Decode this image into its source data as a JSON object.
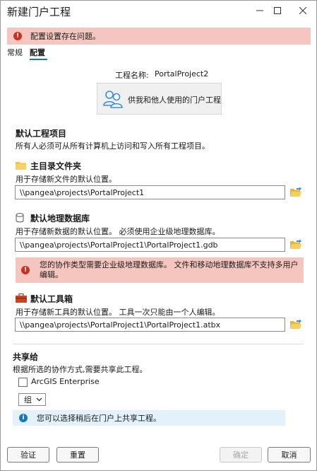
{
  "window": {
    "title": "新建门户工程",
    "minimize_icon": "minimize-icon",
    "maximize_icon": "maximize-icon",
    "close_icon": "close-icon"
  },
  "error_banner": {
    "text": "配置设置存在问题。",
    "icon": "error-icon"
  },
  "tabs": [
    {
      "label": "常规",
      "selected": false
    },
    {
      "label": "配置",
      "selected": true
    }
  ],
  "project": {
    "name_label": "工程名称:",
    "name_value": "PortalProject2",
    "type_label": "供我和他人使用的门户工程",
    "type_icon": "users-icon"
  },
  "defaults": {
    "title": "默认工程项目",
    "description": "所有人必须可从所有计算机上访问和写入所有工程项目。"
  },
  "home_folder": {
    "title": "主目录文件夹",
    "icon": "folder-icon",
    "description": "用于存储新文件的默认位置。",
    "path": "\\\\pangea\\projects\\PortalProject1"
  },
  "geodatabase": {
    "title": "默认地理数据库",
    "icon": "database-icon",
    "description": "用于存储新数据的默认位置。 必须使用企业级地理数据库。",
    "path": "\\\\pangea\\projects\\PortalProject1\\PortalProject1.gdb",
    "warning": "您的协作类型需要企业级地理数据库。 文件和移动地理数据库不支持多用户编辑。"
  },
  "toolbox": {
    "title": "默认工具箱",
    "icon": "toolbox-icon",
    "description": "用于存储新工具的默认位置。 工具一次只能由一个人编辑。",
    "path": "\\\\pangea\\projects\\PortalProject1\\PortalProject1.atbx"
  },
  "share": {
    "title": "共享给",
    "description": "根据所选的协作方式,需要共享此工程。",
    "checkbox_label": "ArcGIS Enterprise",
    "checkbox_checked": false,
    "select_value": "组",
    "info": "您可以选择稍后在门户上共享工程。"
  },
  "buttons": {
    "validate": "验证",
    "reset": "重置",
    "ok": "确定",
    "cancel": "取消"
  },
  "colors": {
    "accent": "#1776bd",
    "error_bg": "#f5c6bf",
    "error_icon": "#c8321f",
    "info_bg": "#e3f1fb"
  }
}
